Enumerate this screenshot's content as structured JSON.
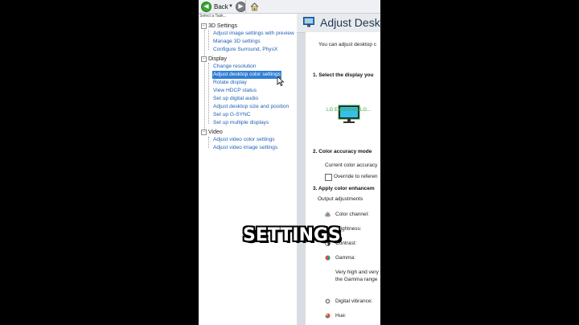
{
  "toolbar": {
    "back_label": "Back"
  },
  "left_pane": {
    "task_label": "Select a Task...",
    "categories": [
      {
        "label": "3D Settings",
        "items": [
          "Adjust image settings with preview",
          "Manage 3D settings",
          "Configure Surround, PhysX"
        ]
      },
      {
        "label": "Display",
        "items": [
          "Change resolution",
          "Adjust desktop color settings",
          "Rotate display",
          "View HDCP status",
          "Set up digital audio",
          "Adjust desktop size and position",
          "Set up G-SYNC",
          "Set up multiple displays"
        ]
      },
      {
        "label": "Video",
        "items": [
          "Adjust video color settings",
          "Adjust video image settings"
        ]
      }
    ],
    "selected_item": "Adjust desktop color settings"
  },
  "right_pane": {
    "title": "Adjust Desk",
    "description": "You can adjust desktop c",
    "section1": "1. Select the display you",
    "display_name": "LG Electronics LG...",
    "section2": "2. Color accuracy mode",
    "current_color": "Current color accuracy",
    "override": "Override to referen",
    "section3": "3. Apply color enhancem",
    "output_adjustments": "Output adjustments",
    "color_channel": "Color channel:",
    "brightness": "Brightness:",
    "contrast": "Contrast:",
    "gamma": "Gamma:",
    "gamma_note_1": "Very high and very",
    "gamma_note_2": "the Gamma range",
    "digital_vibrance": "Digital vibrance:",
    "hue": "Hue:"
  },
  "caption": "SETTINGS",
  "colors": {
    "accent_selected": "#2f7fd4",
    "link": "#1f5fb4",
    "back_button": "#38a62f",
    "display_name": "#3aa64a"
  }
}
